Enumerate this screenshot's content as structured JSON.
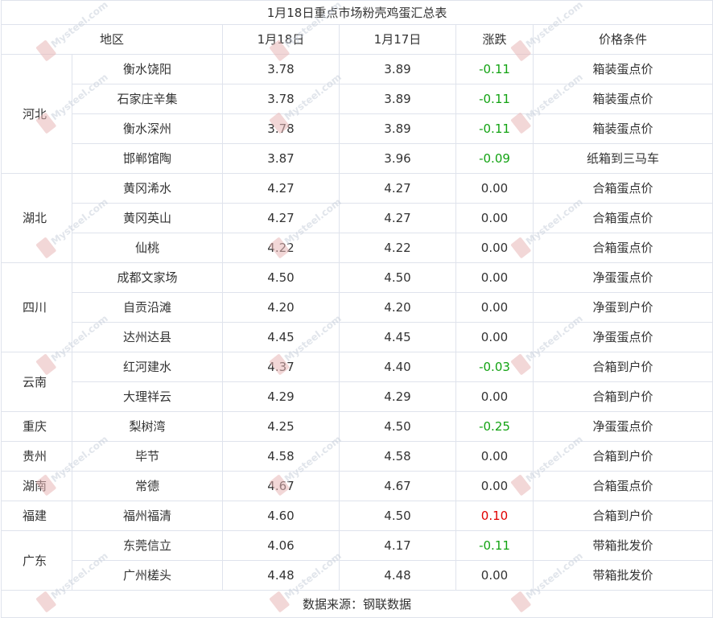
{
  "title": "1月18日重点市场粉壳鸡蛋汇总表",
  "headers": [
    "地区",
    "1月18日",
    "1月17日",
    "涨跌",
    "价格条件"
  ],
  "groups": [
    {
      "region": "河北",
      "rows": [
        {
          "market": "衡水饶阳",
          "d18": "3.78",
          "d17": "3.89",
          "change": "-0.11",
          "trend": "down",
          "condition": "箱装蛋点价"
        },
        {
          "market": "石家庄辛集",
          "d18": "3.78",
          "d17": "3.89",
          "change": "-0.11",
          "trend": "down",
          "condition": "箱装蛋点价"
        },
        {
          "market": "衡水深州",
          "d18": "3.78",
          "d17": "3.89",
          "change": "-0.11",
          "trend": "down",
          "condition": "箱装蛋点价"
        },
        {
          "market": "邯郸馆陶",
          "d18": "3.87",
          "d17": "3.96",
          "change": "-0.09",
          "trend": "down",
          "condition": "纸箱到三马车"
        }
      ]
    },
    {
      "region": "湖北",
      "rows": [
        {
          "market": "黄冈浠水",
          "d18": "4.27",
          "d17": "4.27",
          "change": "0.00",
          "trend": "flat",
          "condition": "合箱蛋点价"
        },
        {
          "market": "黄冈英山",
          "d18": "4.27",
          "d17": "4.27",
          "change": "0.00",
          "trend": "flat",
          "condition": "合箱蛋点价"
        },
        {
          "market": "仙桃",
          "d18": "4.22",
          "d17": "4.22",
          "change": "0.00",
          "trend": "flat",
          "condition": "合箱蛋点价"
        }
      ]
    },
    {
      "region": "四川",
      "rows": [
        {
          "market": "成都文家场",
          "d18": "4.50",
          "d17": "4.50",
          "change": "0.00",
          "trend": "flat",
          "condition": "净蛋蛋点价"
        },
        {
          "market": "自贡沿滩",
          "d18": "4.20",
          "d17": "4.20",
          "change": "0.00",
          "trend": "flat",
          "condition": "净蛋到户价"
        },
        {
          "market": "达州达县",
          "d18": "4.45",
          "d17": "4.45",
          "change": "0.00",
          "trend": "flat",
          "condition": "净蛋蛋点价"
        }
      ]
    },
    {
      "region": "云南",
      "rows": [
        {
          "market": "红河建水",
          "d18": "4.37",
          "d17": "4.40",
          "change": "-0.03",
          "trend": "down",
          "condition": "合箱到户价"
        },
        {
          "market": "大理祥云",
          "d18": "4.29",
          "d17": "4.29",
          "change": "0.00",
          "trend": "flat",
          "condition": "合箱到户价"
        }
      ]
    },
    {
      "region": "重庆",
      "rows": [
        {
          "market": "梨树湾",
          "d18": "4.25",
          "d17": "4.50",
          "change": "-0.25",
          "trend": "down",
          "condition": "净蛋蛋点价"
        }
      ]
    },
    {
      "region": "贵州",
      "rows": [
        {
          "market": "毕节",
          "d18": "4.58",
          "d17": "4.58",
          "change": "0.00",
          "trend": "flat",
          "condition": "合箱到户价"
        }
      ]
    },
    {
      "region": "湖南",
      "rows": [
        {
          "market": "常德",
          "d18": "4.67",
          "d17": "4.67",
          "change": "0.00",
          "trend": "flat",
          "condition": "合箱蛋点价"
        }
      ]
    },
    {
      "region": "福建",
      "rows": [
        {
          "market": "福州福清",
          "d18": "4.60",
          "d17": "4.50",
          "change": "0.10",
          "trend": "up",
          "condition": "合箱到户价"
        }
      ]
    },
    {
      "region": "广东",
      "rows": [
        {
          "market": "东莞信立",
          "d18": "4.06",
          "d17": "4.17",
          "change": "-0.11",
          "trend": "down",
          "condition": "带箱批发价"
        },
        {
          "market": "广州槎头",
          "d18": "4.48",
          "d17": "4.48",
          "change": "0.00",
          "trend": "flat",
          "condition": "带箱批发价"
        }
      ]
    }
  ],
  "footer": "数据来源：钢联数据",
  "watermark": "Mysteel.com",
  "colors": {
    "up": "#e10000",
    "down": "#13a313",
    "flat": "#333333",
    "border": "#dfe3ec"
  }
}
